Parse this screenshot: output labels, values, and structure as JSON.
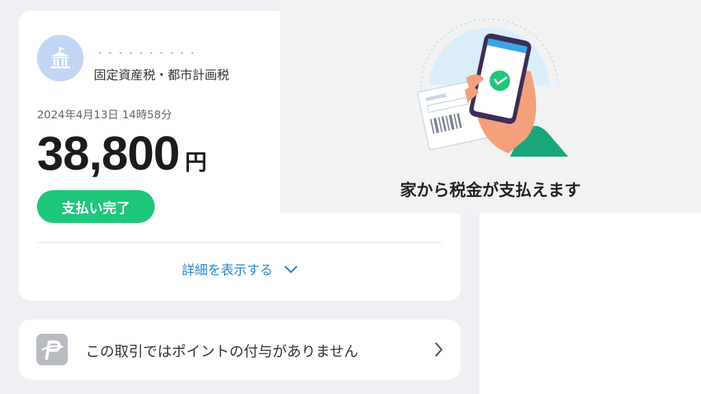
{
  "payment": {
    "payee_name": "・・・・・・・・・・",
    "tax_type": "固定資産税・都市計画税",
    "datetime": "2024年4月13日 14時58分",
    "amount": "38,800",
    "currency": "円",
    "status": "支払い完了",
    "details_label": "詳細を表示する"
  },
  "points": {
    "message": "この取引ではポイントの付与がありません"
  },
  "ad": {
    "title": "家から税金が支払えます"
  },
  "colors": {
    "status_green": "#1ec77a",
    "link_blue": "#2a86d6",
    "avatar_blue": "#c3d6f5"
  },
  "icons": [
    "government-building-icon",
    "chevron-down-icon",
    "paypay-logo-icon",
    "chevron-right-icon",
    "checkmark-icon"
  ]
}
